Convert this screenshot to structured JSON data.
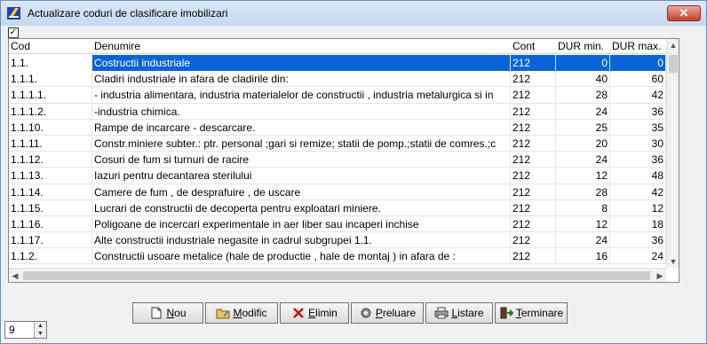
{
  "window": {
    "title": "Actualizare coduri de clasificare imobilizari",
    "close_label": "✕"
  },
  "grid": {
    "columns": [
      "Cod",
      "Denumire",
      "Cont",
      "DUR min.",
      "DUR max."
    ],
    "rows": [
      {
        "cod": "1.1.",
        "denumire": "Costructii industriale",
        "cont": "212",
        "dur_min": "0",
        "dur_max": "0"
      },
      {
        "cod": "1.1.1.",
        "denumire": "Cladiri industriale in afara de cladirile din:",
        "cont": "212",
        "dur_min": "40",
        "dur_max": "60"
      },
      {
        "cod": "1.1.1.1.",
        "denumire": "- industria alimentara, industria materialelor de constructii , industria metalurgica si in",
        "cont": "212",
        "dur_min": "28",
        "dur_max": "42"
      },
      {
        "cod": "1.1.1.2.",
        "denumire": "-industria chimica.",
        "cont": "212",
        "dur_min": "24",
        "dur_max": "36"
      },
      {
        "cod": "1.1.10.",
        "denumire": "Rampe de incarcare - descarcare.",
        "cont": "212",
        "dur_min": "25",
        "dur_max": "35"
      },
      {
        "cod": "1.1.11.",
        "denumire": "Constr.miniere subter.: ptr. personal ;gari si remize; statii de pomp.;statii de comres.;c",
        "cont": "212",
        "dur_min": "20",
        "dur_max": "30"
      },
      {
        "cod": "1.1.12.",
        "denumire": "Cosuri de fum si turnuri de racire",
        "cont": "212",
        "dur_min": "24",
        "dur_max": "36"
      },
      {
        "cod": "1.1.13.",
        "denumire": "Iazuri pentru decantarea sterilului",
        "cont": "212",
        "dur_min": "12",
        "dur_max": "48"
      },
      {
        "cod": "1.1.14.",
        "denumire": "Camere de fum , de desprafuire , de uscare",
        "cont": "212",
        "dur_min": "28",
        "dur_max": "42"
      },
      {
        "cod": "1.1.15.",
        "denumire": "Lucrari de constructii de decoperta pentru exploatari miniere.",
        "cont": "212",
        "dur_min": "8",
        "dur_max": "12"
      },
      {
        "cod": "1.1.16.",
        "denumire": "Poligoane de incercari experimentale in aer liber sau incaperi inchise",
        "cont": "212",
        "dur_min": "12",
        "dur_max": "18"
      },
      {
        "cod": "1.1.17.",
        "denumire": "Alte constructii industriale negasite in cadrul subgrupei 1.1.",
        "cont": "212",
        "dur_min": "24",
        "dur_max": "36"
      },
      {
        "cod": "1.1.2.",
        "denumire": "Constructii usoare metalice (hale de productie , hale de montaj ) in afara de :",
        "cont": "212",
        "dur_min": "16",
        "dur_max": "24"
      }
    ]
  },
  "buttons": [
    {
      "key": "N",
      "rest": "ou",
      "icon": "new-document-icon"
    },
    {
      "key": "M",
      "rest": "odific",
      "icon": "edit-folder-icon"
    },
    {
      "key": "E",
      "rest": "limin",
      "icon": "delete-x-icon"
    },
    {
      "key": "P",
      "rest": "reluare",
      "icon": "gear-icon"
    },
    {
      "key": "L",
      "rest": "istare",
      "icon": "printer-icon"
    },
    {
      "key": "T",
      "rest": "erminare",
      "icon": "exit-door-icon"
    }
  ],
  "spinner": {
    "value": "9"
  },
  "colors": {
    "selection": "#0a64d8",
    "close_button": "#c7402d"
  }
}
